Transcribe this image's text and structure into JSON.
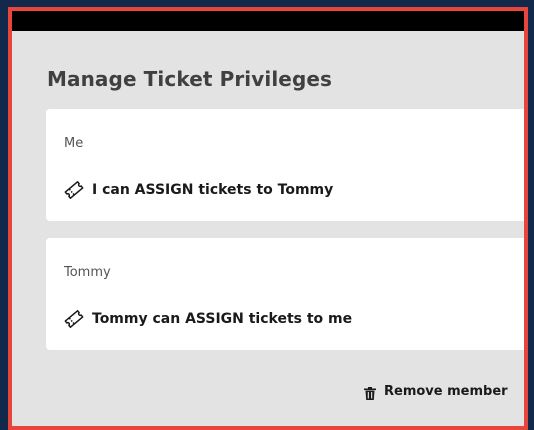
{
  "panel": {
    "title": "Manage Ticket Privileges"
  },
  "privileges": [
    {
      "owner": "Me",
      "text": "I can ASSIGN tickets to Tommy",
      "icon": "ticket-icon"
    },
    {
      "owner": "Tommy",
      "text": "Tommy can ASSIGN tickets to me",
      "icon": "ticket-icon"
    }
  ],
  "actions": {
    "remove_member_label": "Remove member",
    "remove_member_icon": "trash-icon"
  },
  "colors": {
    "frame_border": "#e8453c",
    "panel_background": "#e3e3e3",
    "page_background": "#13294b",
    "top_bar": "#000000"
  }
}
